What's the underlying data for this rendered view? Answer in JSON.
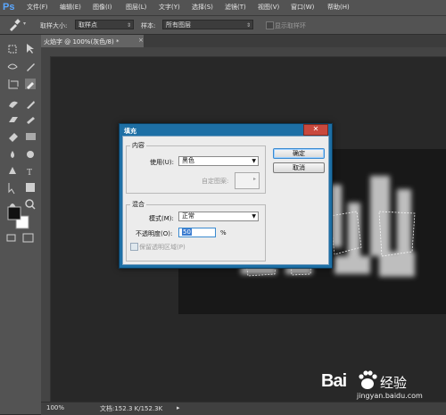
{
  "app": {
    "logo": "Ps"
  },
  "menu": [
    "文件(F)",
    "编辑(E)",
    "图像(I)",
    "图层(L)",
    "文字(Y)",
    "选择(S)",
    "滤镜(T)",
    "视图(V)",
    "窗口(W)",
    "帮助(H)"
  ],
  "options": {
    "sample_size_label": "取样大小:",
    "sample_size_value": "取样点",
    "sample_label": "样本:",
    "sample_value": "所有图层",
    "show_ring_label": "显示取样环"
  },
  "document": {
    "tab_title": "火焰字 @ 100%(灰色/8) *",
    "close": "×"
  },
  "status": {
    "zoom": "100%",
    "doc_info": "文档:152.3 K/152.3K"
  },
  "dialog": {
    "title": "填充",
    "close": "✕",
    "content_group": "内容",
    "use_label": "使用(U):",
    "use_value": "黑色",
    "custom_pattern_label": "自定图案:",
    "blend_group": "混合",
    "mode_label": "模式(M):",
    "mode_value": "正常",
    "opacity_label": "不透明度(O):",
    "opacity_value": "50",
    "opacity_unit": "%",
    "preserve_label": "保留透明区域(P)",
    "ok_label": "确定",
    "cancel_label": "取消"
  },
  "watermark": {
    "brand": "Bai",
    "brand2": "经验",
    "url": "jingyan.baidu.com"
  },
  "colors": {
    "accent": "#1d6fa5",
    "menubar": "#535353",
    "canvas": "#282828"
  }
}
